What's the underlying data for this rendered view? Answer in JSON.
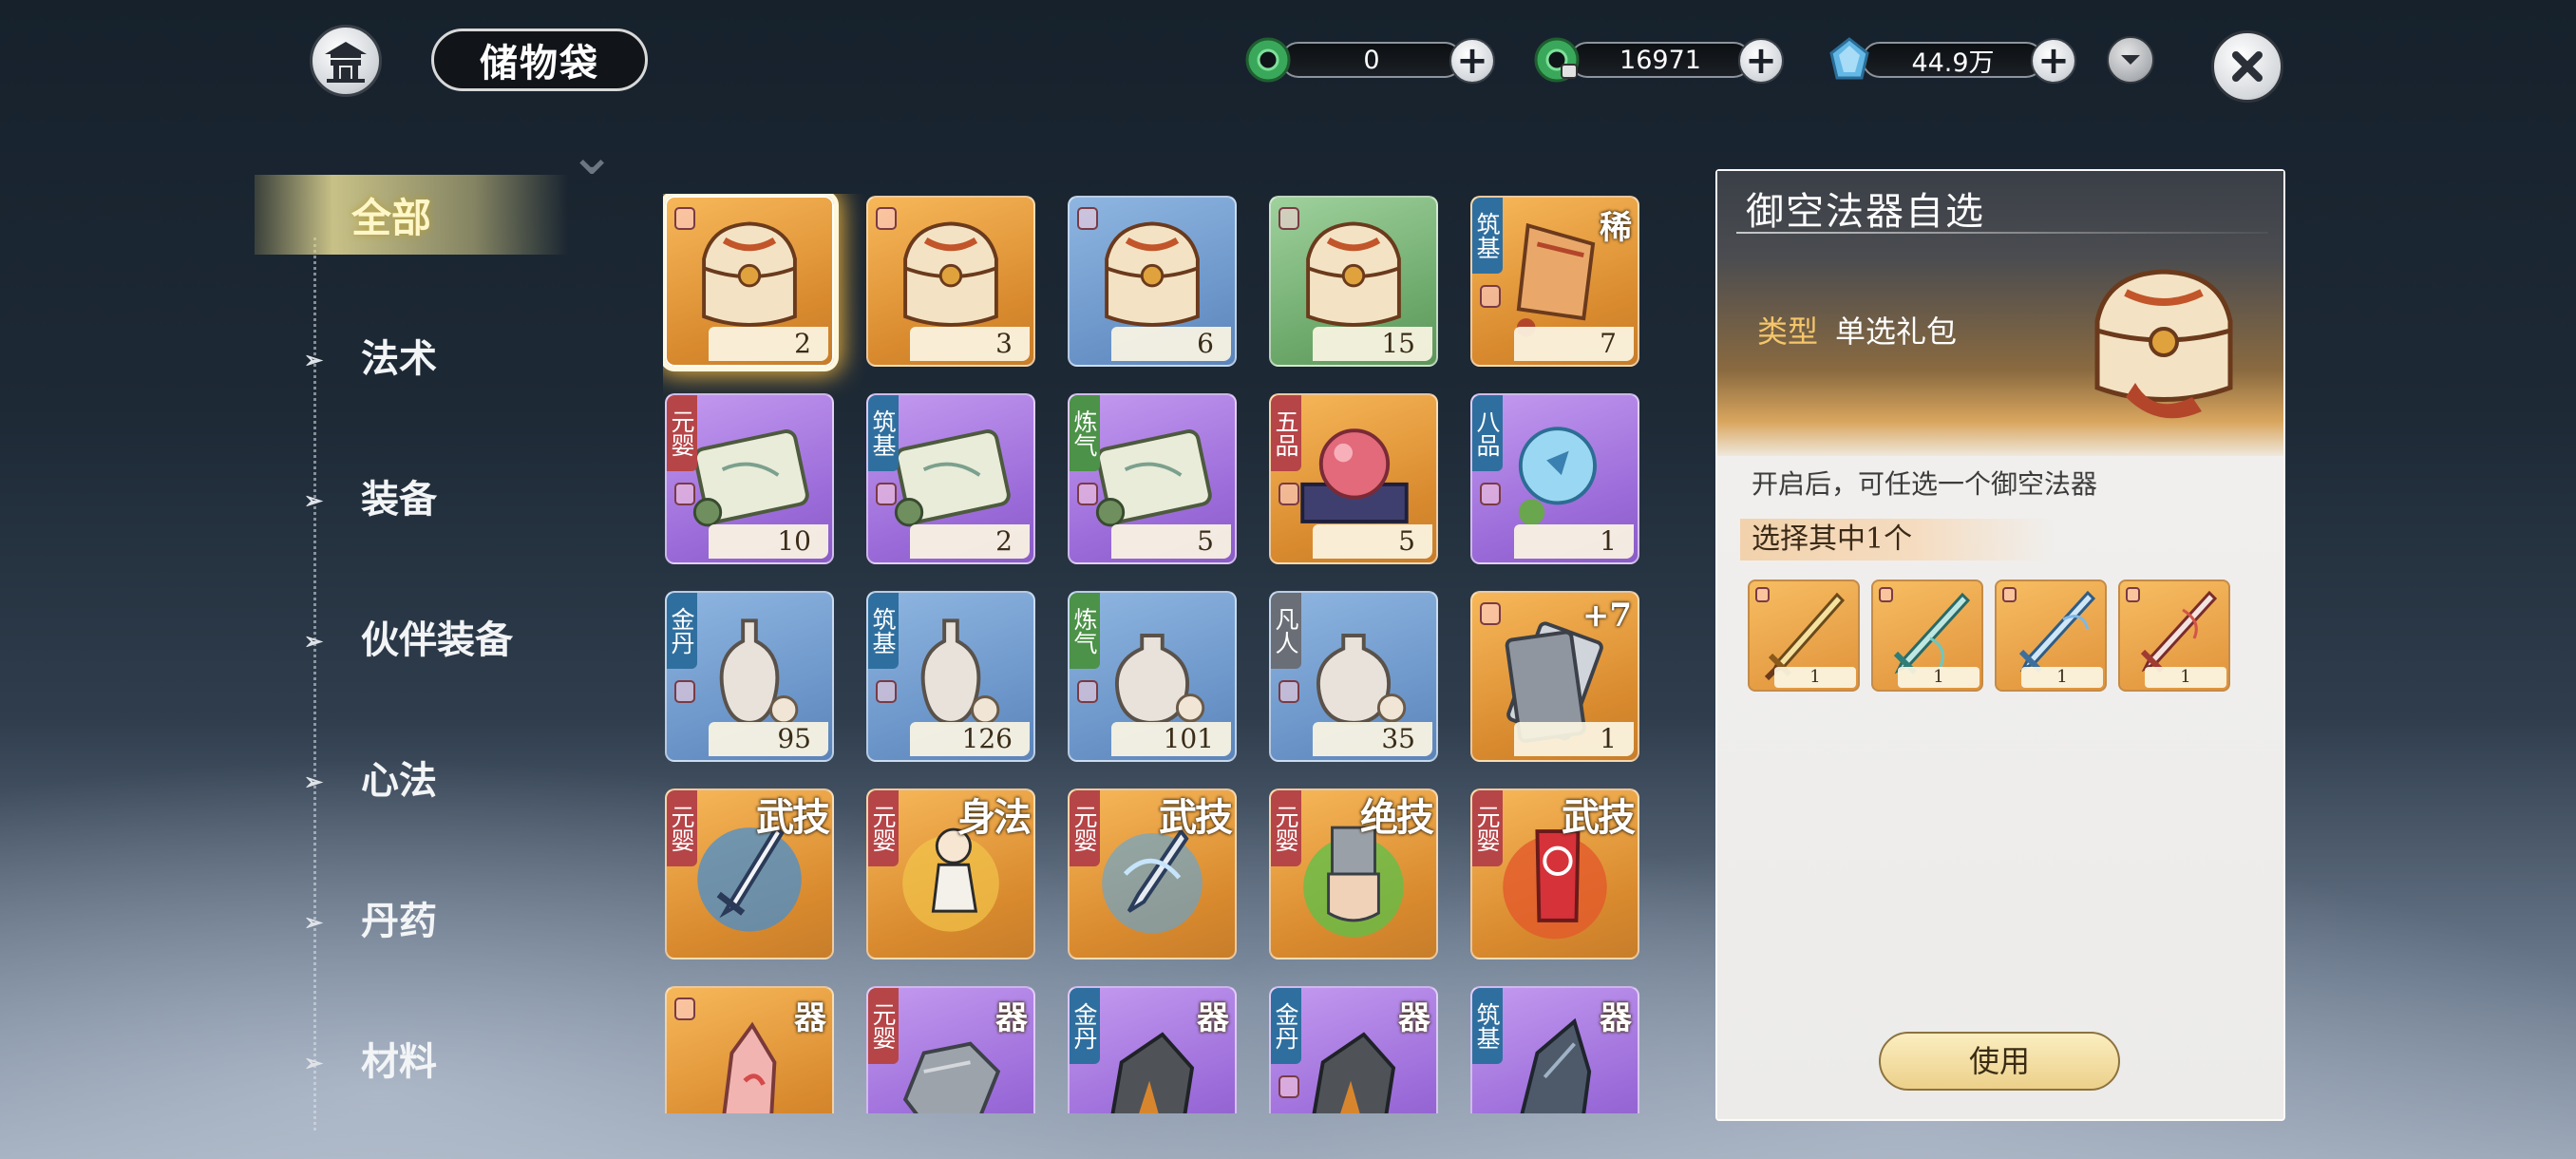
{
  "header": {
    "title": "储物袋",
    "currencies": [
      {
        "name": "jade",
        "value": "0"
      },
      {
        "name": "bound-jade",
        "value": "16971"
      },
      {
        "name": "spirit-stone",
        "value": "44.9万"
      }
    ]
  },
  "sidebar": {
    "items": [
      {
        "label": "全部",
        "active": true
      },
      {
        "label": "法术"
      },
      {
        "label": "装备"
      },
      {
        "label": "伙伴装备"
      },
      {
        "label": "心法"
      },
      {
        "label": "丹药"
      },
      {
        "label": "材料"
      }
    ]
  },
  "grid": {
    "items": [
      {
        "icon": "treasure-chest-icon",
        "bg": "orange",
        "count": "2",
        "selected": true,
        "lock": true
      },
      {
        "icon": "treasure-chest-icon",
        "bg": "orange",
        "count": "3",
        "lock": true
      },
      {
        "icon": "treasure-chest-icon",
        "bg": "blue",
        "count": "6",
        "lock": true
      },
      {
        "icon": "treasure-chest-icon",
        "bg": "green",
        "count": "15",
        "lock": true
      },
      {
        "icon": "scroll-bag-icon",
        "bg": "orange",
        "count": "7",
        "tag": "筑基",
        "corner": "稀",
        "lock": true
      },
      {
        "icon": "scroll-icon",
        "bg": "purple",
        "count": "10",
        "tag": "元婴",
        "lock": true
      },
      {
        "icon": "scroll-icon",
        "bg": "purple",
        "count": "2",
        "tag": "筑基",
        "lock": true
      },
      {
        "icon": "scroll-icon",
        "bg": "purple",
        "count": "5",
        "tag": "炼气",
        "lock": true
      },
      {
        "icon": "red-orb-icon",
        "bg": "orange",
        "count": "5",
        "tag": "五品",
        "lock": true
      },
      {
        "icon": "blue-orb-icon",
        "bg": "purple",
        "count": "1",
        "tag": "八品",
        "lock": true
      },
      {
        "icon": "gourd-bottle-icon",
        "bg": "blue",
        "count": "95",
        "tag": "金丹",
        "lock": true
      },
      {
        "icon": "gourd-bottle-icon",
        "bg": "blue",
        "count": "126",
        "tag": "筑基",
        "lock": true
      },
      {
        "icon": "pill-jar-icon",
        "bg": "blue",
        "count": "101",
        "tag": "炼气",
        "lock": true
      },
      {
        "icon": "pill-jar-icon",
        "bg": "blue",
        "count": "35",
        "tag": "凡人",
        "lock": true
      },
      {
        "icon": "talisman-card-icon",
        "bg": "orange",
        "count": "1",
        "corner": "+7",
        "lock": true
      },
      {
        "icon": "sword-skill-icon",
        "bg": "orange",
        "tag": "元婴",
        "corner": "武技"
      },
      {
        "icon": "movement-skill-icon",
        "bg": "orange",
        "tag": "元婴",
        "corner": "身法"
      },
      {
        "icon": "blade-skill-icon",
        "bg": "orange",
        "tag": "元婴",
        "corner": "武技"
      },
      {
        "icon": "fist-skill-icon",
        "bg": "orange",
        "tag": "元婴",
        "corner": "绝技"
      },
      {
        "icon": "fire-skill-icon",
        "bg": "orange",
        "tag": "元婴",
        "corner": "武技"
      },
      {
        "icon": "crystal-ore-icon",
        "bg": "orange",
        "corner": "器",
        "lock": true
      },
      {
        "icon": "stone-ore-icon",
        "bg": "purple",
        "tag": "元婴",
        "corner": "器"
      },
      {
        "icon": "dark-ore-icon",
        "bg": "purple",
        "tag": "金丹",
        "corner": "器"
      },
      {
        "icon": "dark-ore-icon",
        "bg": "purple",
        "tag": "金丹",
        "corner": "器",
        "lock": true
      },
      {
        "icon": "iron-ore-icon",
        "bg": "purple",
        "tag": "筑基",
        "corner": "器"
      }
    ]
  },
  "detail": {
    "title": "御空法器自选",
    "type_label": "类型",
    "type_value": "单选礼包",
    "description": "开启后，可任选一个御空法器",
    "choose_label": "选择其中1个",
    "options": [
      {
        "icon": "golden-sword-icon",
        "count": "1"
      },
      {
        "icon": "jade-sword-icon",
        "count": "1"
      },
      {
        "icon": "blue-sword-icon",
        "count": "1"
      },
      {
        "icon": "red-sword-icon",
        "count": "1"
      }
    ],
    "use_button": "使用"
  },
  "colors": {
    "accent_gold": "#f5c66a",
    "selected_glow": "#f2b640"
  }
}
